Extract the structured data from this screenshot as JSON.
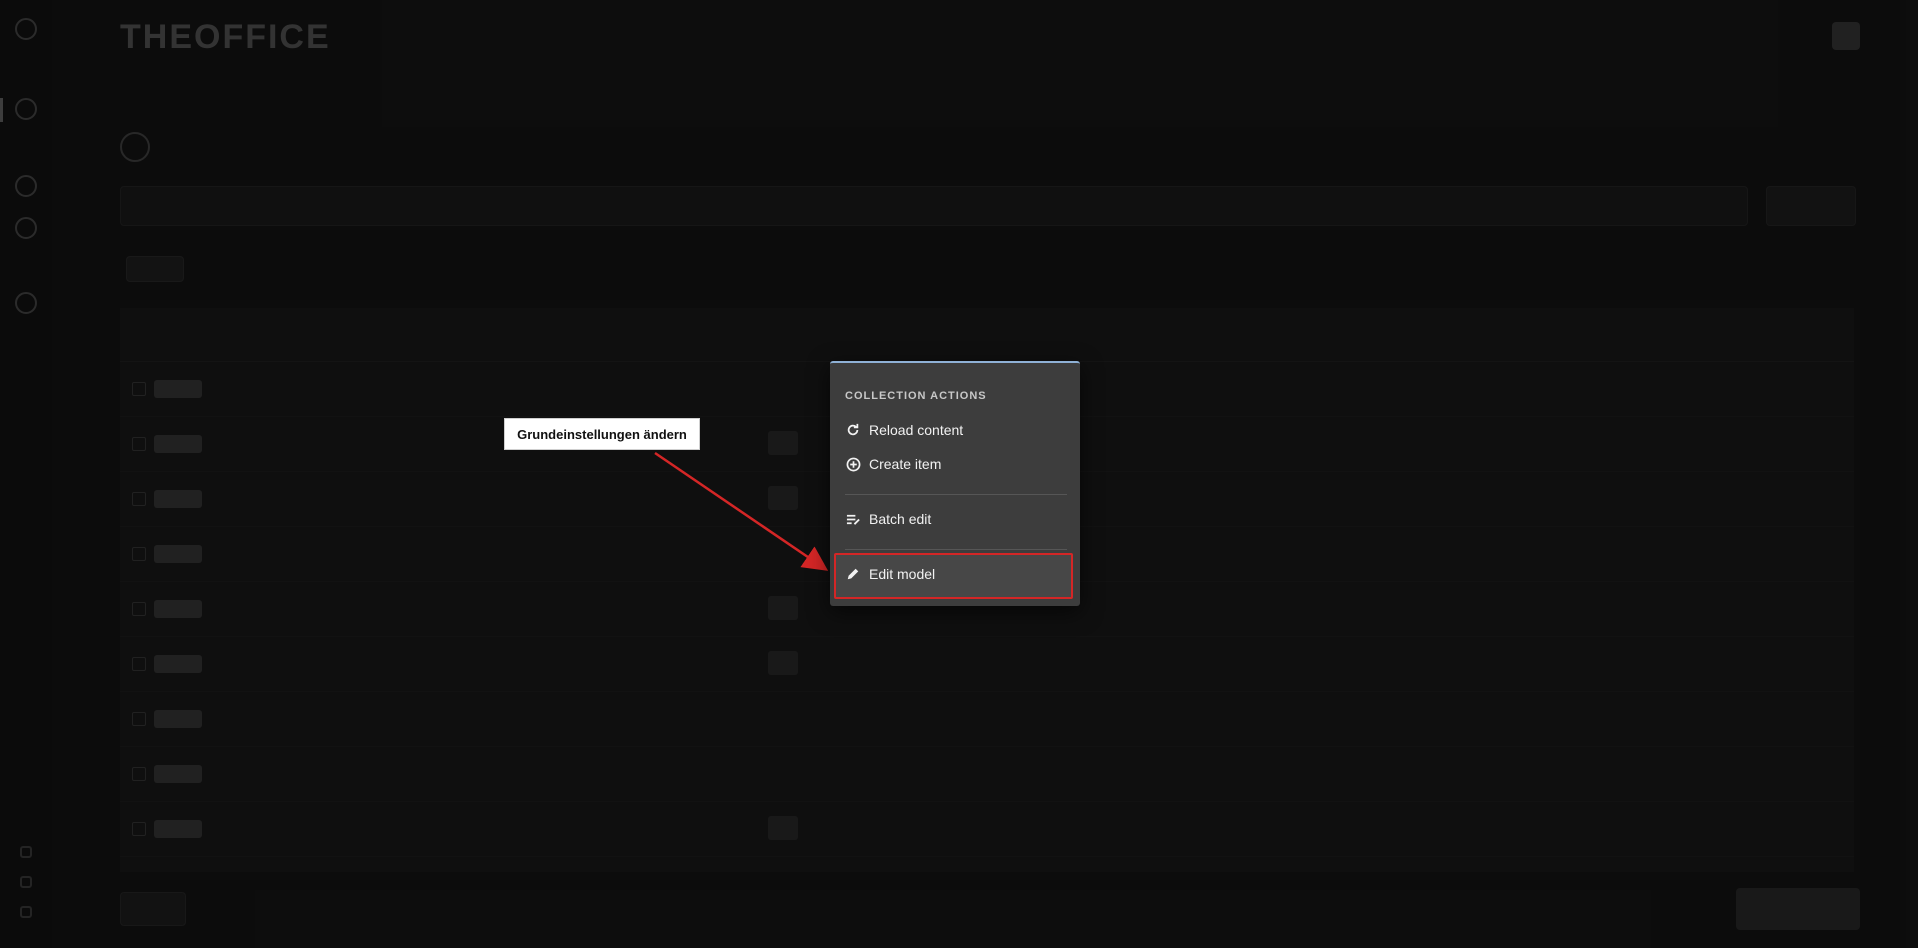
{
  "popover": {
    "heading": "COLLECTION ACTIONS",
    "items": [
      {
        "label": "Reload content",
        "icon": "reload-icon"
      },
      {
        "label": "Create item",
        "icon": "plus-circle-icon"
      },
      {
        "label": "Batch edit",
        "icon": "batch-edit-icon"
      },
      {
        "label": "Edit model",
        "icon": "pencil-icon",
        "highlighted": true
      }
    ]
  },
  "annotation": {
    "text": "Grundeinstellungen ändern",
    "color": "#d42626"
  },
  "colors": {
    "accent": "#8fb1d6",
    "highlight": "#d42626",
    "menu_bg": "#3d3d3d"
  }
}
